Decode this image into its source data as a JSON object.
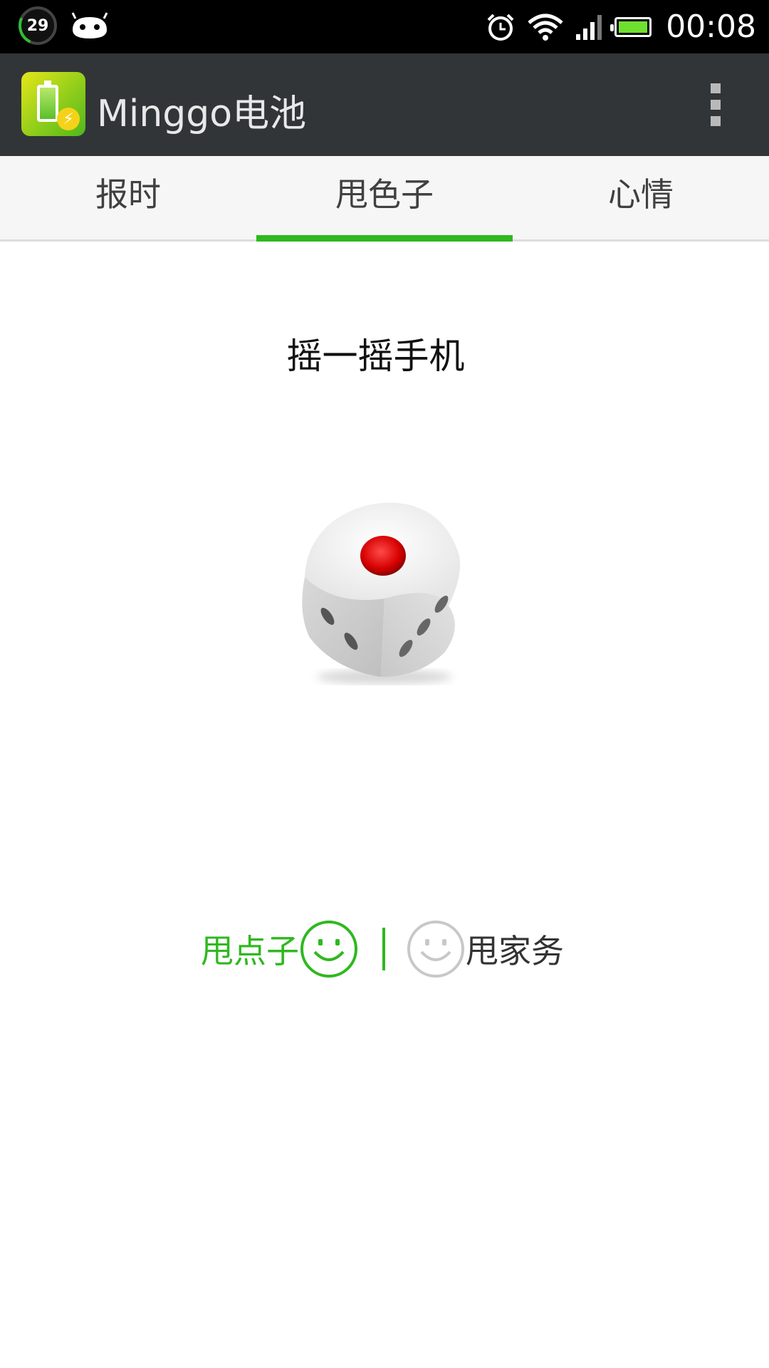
{
  "status_bar": {
    "badge_number": "29",
    "time": "00:08",
    "icons": [
      "android-icon",
      "alarm-icon",
      "wifi-icon",
      "signal-icon",
      "battery-icon"
    ]
  },
  "app_bar": {
    "title": "Minggo电池",
    "menu_icon": "overflow-menu-icon"
  },
  "tabs": [
    {
      "label": "报时",
      "active": false
    },
    {
      "label": "甩色子",
      "active": true
    },
    {
      "label": "心情",
      "active": false
    }
  ],
  "main": {
    "hint": "摇一摇手机",
    "dice_face": 1
  },
  "options": {
    "left_label": "甩点子",
    "right_label": "甩家务"
  },
  "colors": {
    "accent_green": "#2fb81f",
    "appbar": "#313538",
    "tab_bg": "#f6f6f6",
    "dice_dot": "#e00000"
  }
}
